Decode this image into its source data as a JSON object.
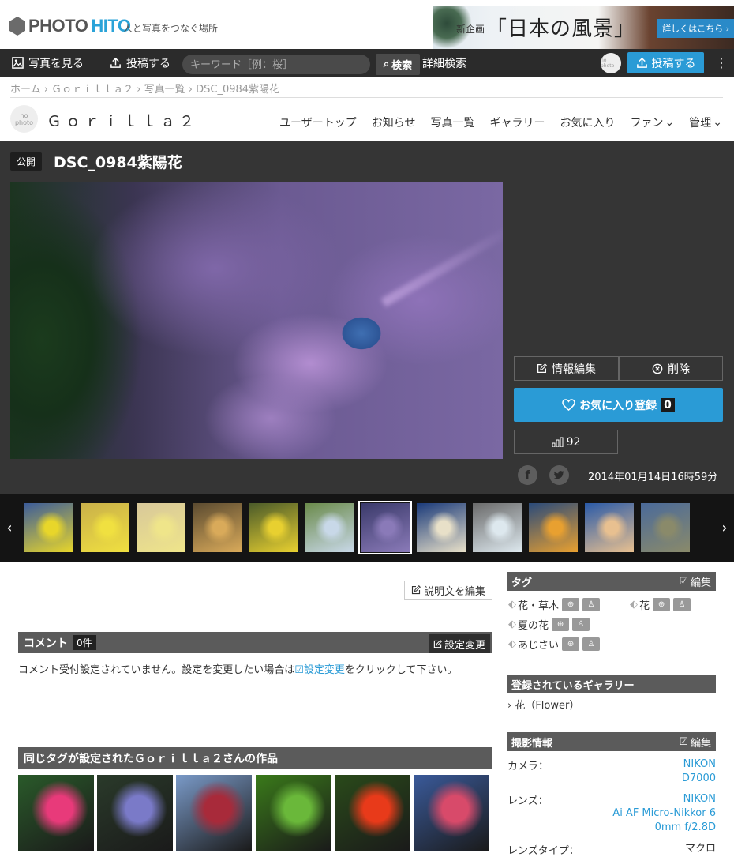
{
  "site": {
    "logo_part1": "PHOTO",
    "logo_part2": "HITO",
    "tagline": "人と写真をつなぐ場所"
  },
  "banner": {
    "new_label": "新企画",
    "title": "「日本の風景」",
    "button": "詳しくはこちら ›"
  },
  "navbar": {
    "view_photos": "写真を見る",
    "post": "投稿する",
    "search_placeholder": "キーワード［例：桜］",
    "search_button": "検索",
    "advanced_search": "詳細検索",
    "avatar_text": "no photo",
    "post_button": "投稿する",
    "more": "⋮"
  },
  "breadcrumb": [
    "ホーム",
    "Ｇｏｒｉｌｌａ２",
    "写真一覧",
    "DSC_0984紫陽花"
  ],
  "user": {
    "avatar_top": "no",
    "avatar_bottom": "photo",
    "name": "Ｇｏｒｉｌｌａ２",
    "nav": [
      "ユーザートップ",
      "お知らせ",
      "写真一覧",
      "ギャラリー",
      "お気に入り",
      "ファン",
      "管理"
    ]
  },
  "photo": {
    "status": "公開",
    "title": "DSC_0984紫陽花",
    "edit_info": "情報編集",
    "delete": "削除",
    "favorite": "お気に入り登録",
    "favorite_count": "0",
    "views": "92",
    "date": "2014年01月14日16時59分"
  },
  "thumbs": [
    {
      "colors": [
        "#3c5c9a",
        "#e8d62a"
      ]
    },
    {
      "colors": [
        "#c9b04a",
        "#f0e040"
      ]
    },
    {
      "colors": [
        "#d8c89a",
        "#efe58a"
      ]
    },
    {
      "colors": [
        "#5a4a30",
        "#d9aa5a"
      ]
    },
    {
      "colors": [
        "#4a5a2a",
        "#e8d030"
      ]
    },
    {
      "colors": [
        "#6a8a4a",
        "#c8d8e8"
      ]
    },
    {
      "colors": [
        "#3a3a6a",
        "#8a7ab8"
      ],
      "selected": true
    },
    {
      "colors": [
        "#1a3a7a",
        "#e8e0c8"
      ]
    },
    {
      "colors": [
        "#6a6a6a",
        "#dde8ee"
      ]
    },
    {
      "colors": [
        "#2a4a7a",
        "#e8a030"
      ]
    },
    {
      "colors": [
        "#2a5aa8",
        "#e8c090"
      ]
    },
    {
      "colors": [
        "#4a6a9a",
        "#8a8a6a"
      ]
    }
  ],
  "description": {
    "edit_button": "説明文を編集"
  },
  "comments": {
    "title": "コメント",
    "count": "0件",
    "settings_button": "設定変更",
    "text_before": "コメント受付設定されていません。設定を変更したい場合は",
    "link": "設定変更",
    "text_after": "をクリックして下さい。"
  },
  "same_tag": {
    "title": "同じタグが設定されたＧｏｒｉｌｌａ２さんの作品",
    "works": [
      {
        "colors": [
          "#2a5a2a",
          "#e83a7a"
        ]
      },
      {
        "colors": [
          "#2a3a2a",
          "#7a7ac8"
        ]
      },
      {
        "colors": [
          "#7a9ac8",
          "#a82a3a"
        ]
      },
      {
        "colors": [
          "#3a7a1a",
          "#6ab83a"
        ]
      },
      {
        "colors": [
          "#2a4a1a",
          "#e83a1a"
        ]
      },
      {
        "colors": [
          "#3a5a9a",
          "#d84a6a"
        ]
      }
    ]
  },
  "tags": {
    "title": "タグ",
    "edit": "編集",
    "items": [
      "花・草木",
      "花",
      "夏の花",
      "あじさい"
    ]
  },
  "gallery": {
    "title": "登録されているギャラリー",
    "item": "› 花（Flower）"
  },
  "specs": {
    "title": "撮影情報",
    "edit": "編集",
    "camera_label": "カメラ：",
    "camera_line1": "NIKON",
    "camera_line2": "D7000",
    "lens_label": "レンズ：",
    "lens_line1": "NIKON",
    "lens_line2": "Ai AF Micro-Nikkor 6",
    "lens_line3": "0mm f/2.8D",
    "lens_type_label": "レンズタイプ：",
    "lens_type": "マクロ"
  },
  "colors": {
    "accent": "#2a9bd6",
    "navbar": "#2b2b2b",
    "photo_bg": "#353535",
    "section_head": "#5b5b5b"
  }
}
